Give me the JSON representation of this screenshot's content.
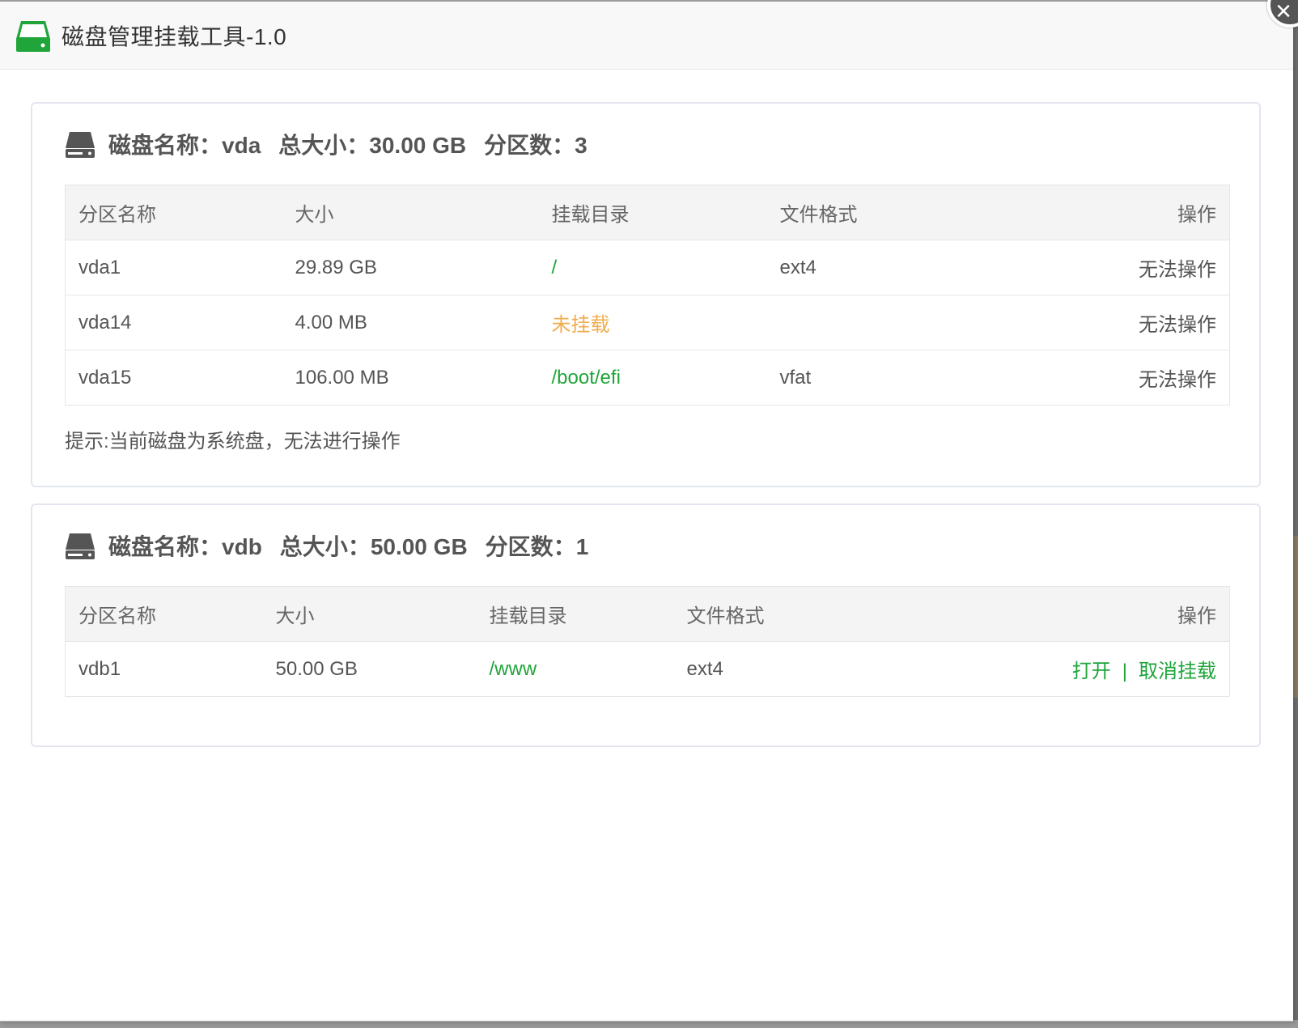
{
  "window": {
    "title": "磁盘管理挂载工具-1.0",
    "close_label": "×"
  },
  "table_headers": {
    "name": "分区名称",
    "size": "大小",
    "mount": "挂载目录",
    "fs": "文件格式",
    "op": "操作"
  },
  "disks": [
    {
      "label_name": "磁盘名称：",
      "name": "vda",
      "label_total": "总大小：",
      "total": "30.00 GB",
      "label_parts": "分区数：",
      "parts_count": "3",
      "partitions": [
        {
          "name": "vda1",
          "size": "29.89 GB",
          "mount": "/",
          "fs": "ext4",
          "op": "无法操作"
        },
        {
          "name": "vda14",
          "size": "4.00 MB",
          "mount": "未挂载",
          "fs": "",
          "op": "无法操作"
        },
        {
          "name": "vda15",
          "size": "106.00 MB",
          "mount": "/boot/efi",
          "fs": "vfat",
          "op": "无法操作"
        }
      ],
      "hint": "提示:当前磁盘为系统盘，无法进行操作"
    },
    {
      "label_name": "磁盘名称：",
      "name": "vdb",
      "label_total": "总大小：",
      "total": "50.00 GB",
      "label_parts": "分区数：",
      "parts_count": "1",
      "partitions": [
        {
          "name": "vdb1",
          "size": "50.00 GB",
          "mount": "/www",
          "fs": "ext4",
          "op_open": "打开",
          "op_sep": "|",
          "op_unmount": "取消挂载"
        }
      ]
    }
  ],
  "colors": {
    "accent_green": "#20a53a",
    "warning_orange": "#f0ad4e",
    "text": "#555555",
    "header_bg": "#f8f8f8"
  }
}
